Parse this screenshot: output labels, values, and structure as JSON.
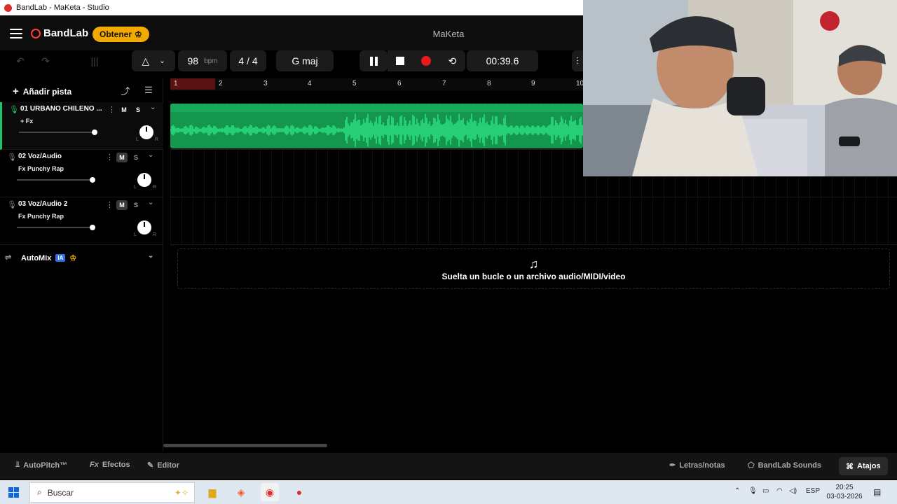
{
  "window": {
    "title": "BandLab - MaKeta - Studio"
  },
  "header": {
    "logo": "BandLab",
    "obtener": "Obtener",
    "project_name": "MaKeta"
  },
  "toolbar": {
    "bpm": "98",
    "bpm_unit": "bpm",
    "time_sig": "4 / 4",
    "key": "G maj",
    "time": "00:39.6"
  },
  "left_panel": {
    "add_track": "Añadir pista",
    "tracks": [
      {
        "name": "01  URBANO CHILENO ...",
        "fx": "+ Fx",
        "mute": "M",
        "solo": "S"
      },
      {
        "name": "02  Voz/Audio",
        "fx": "Fx Punchy Rap",
        "mute": "M",
        "solo": "S"
      },
      {
        "name": "03  Voz/Audio 2",
        "fx": "Fx Punchy Rap",
        "mute": "M",
        "solo": "S"
      }
    ],
    "pan_l": "L",
    "pan_r": "R",
    "automix": "AutoMix",
    "automix_badge": "IA"
  },
  "timeline": {
    "ticks": [
      "1",
      "2",
      "3",
      "4",
      "5",
      "6",
      "7",
      "8",
      "9",
      "10"
    ],
    "drop_text": "Suelta un bucle o un archivo audio/MIDI/video"
  },
  "bottom": {
    "autopitch": "AutoPitch™",
    "efectos": "Efectos",
    "editor": "Editor",
    "letras": "Letras/notas",
    "sounds": "BandLab Sounds",
    "atajos": "Atajos"
  },
  "taskbar": {
    "search": "Buscar",
    "lang": "ESP",
    "time": "20:25",
    "date": "03-03-2026"
  },
  "colors": {
    "accent_green": "#1fc46a",
    "clip_green": "#14964e",
    "record_red": "#e81919",
    "brand_orange": "#f2a900"
  }
}
